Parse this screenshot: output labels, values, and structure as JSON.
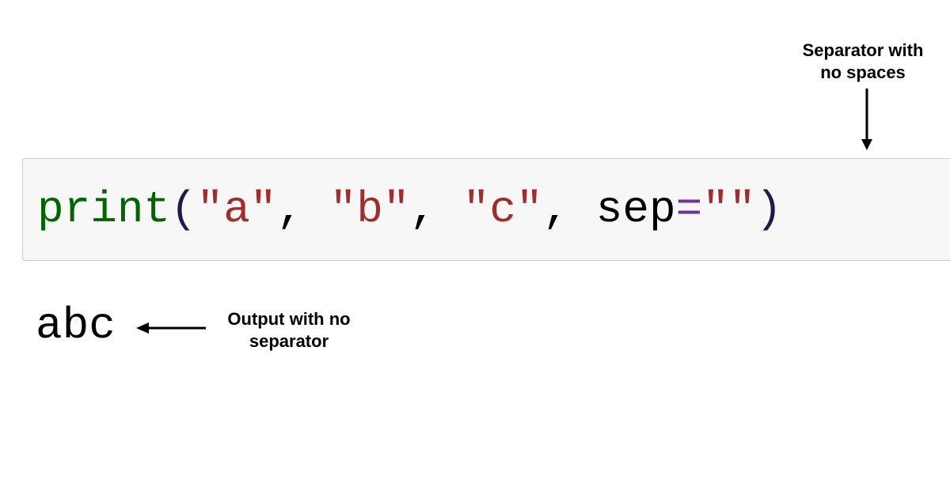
{
  "annotations": {
    "top": "Separator with no spaces",
    "bottom": "Output with no separator"
  },
  "code": {
    "func": "print",
    "open": "(",
    "arg1": "\"a\"",
    "comma": ",",
    "space": " ",
    "arg2": "\"b\"",
    "arg3": "\"c\"",
    "param": "sep",
    "eq": "=",
    "sepval": "\"\"",
    "close": ")"
  },
  "output": "abc"
}
